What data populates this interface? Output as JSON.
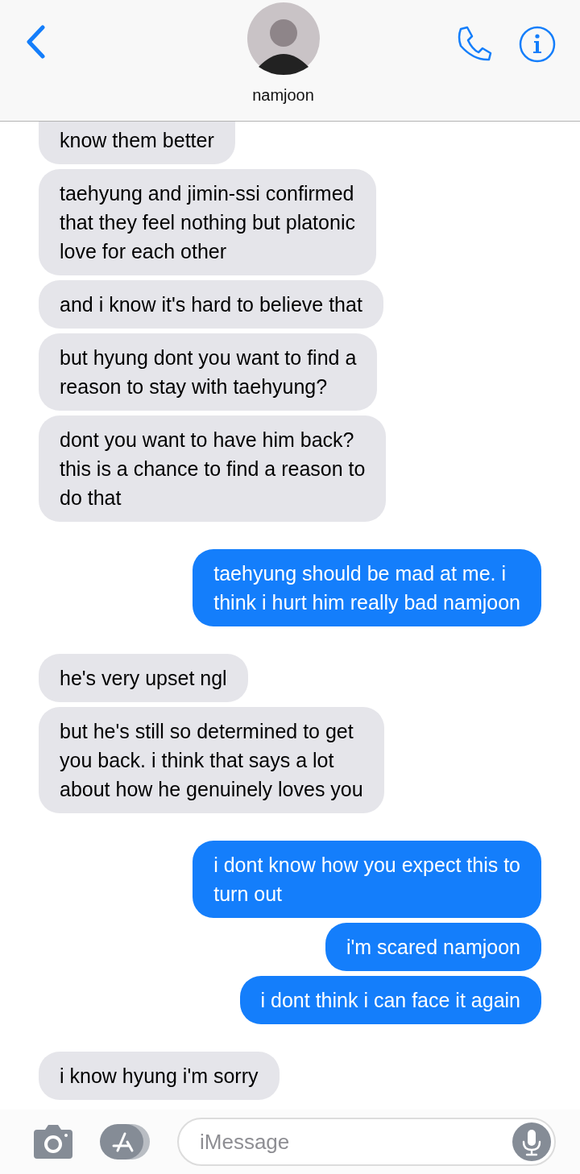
{
  "header": {
    "contact_name": "namjoon"
  },
  "messages": [
    {
      "kind": "received",
      "lines": [
        "know them better"
      ]
    },
    {
      "kind": "received",
      "lines": [
        "taehyung and jimin-ssi confirmed",
        "that they feel nothing but platonic",
        "love for each other"
      ]
    },
    {
      "kind": "received",
      "lines": [
        "and i know it's hard to believe that"
      ]
    },
    {
      "kind": "received",
      "lines": [
        "but hyung dont you want to find a",
        "reason to stay with taehyung?"
      ]
    },
    {
      "kind": "received",
      "lines": [
        "dont you want to have him back?",
        "this is a chance to find a reason to",
        "do that"
      ]
    },
    {
      "kind": "sent",
      "lines": [
        "taehyung should be mad at me. i",
        "think i hurt him really bad namjoon"
      ]
    },
    {
      "kind": "received",
      "lines": [
        "he's very upset ngl"
      ]
    },
    {
      "kind": "received",
      "lines": [
        "but he's still so determined to get",
        "you back. i think that says a lot",
        "about how he genuinely loves you"
      ]
    },
    {
      "kind": "sent",
      "lines": [
        "i dont know how you expect this to",
        "turn out"
      ]
    },
    {
      "kind": "sent",
      "lines": [
        "i'm scared namjoon"
      ]
    },
    {
      "kind": "sent",
      "lines": [
        "i dont think i can face it again"
      ]
    },
    {
      "kind": "received",
      "lines": [
        "i know hyung i'm sorry"
      ]
    }
  ],
  "composer": {
    "placeholder": "iMessage"
  }
}
